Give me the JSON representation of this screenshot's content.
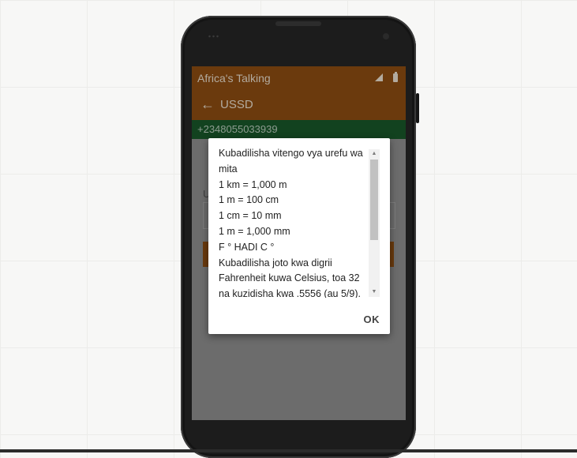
{
  "app": {
    "title": "Africa's Talking"
  },
  "toolbar": {
    "title": "USSD"
  },
  "phone_bar": {
    "number": "+2348055033939"
  },
  "content": {
    "label_fragment": "U"
  },
  "dialog": {
    "lines": [
      "Kubadilisha vitengo vya urefu wa",
      "mita",
      "1 km = 1,000 m",
      "1 m = 100 cm",
      "1 cm = 10 mm",
      "1 m = 1,000 mm",
      "F ° HADI C °",
      "Kubadilisha joto kwa digrii",
      "Fahrenheit kuwa Celsius, toa 32",
      "na kuzidisha kwa .5556 (au 5/9)."
    ],
    "ok_label": "OK"
  },
  "icons": {
    "back": "arrow-left-icon",
    "signal": "signal-icon",
    "battery": "battery-icon"
  },
  "colors": {
    "toolbar": "#6b3a0d",
    "phone_bar": "#12421f"
  }
}
